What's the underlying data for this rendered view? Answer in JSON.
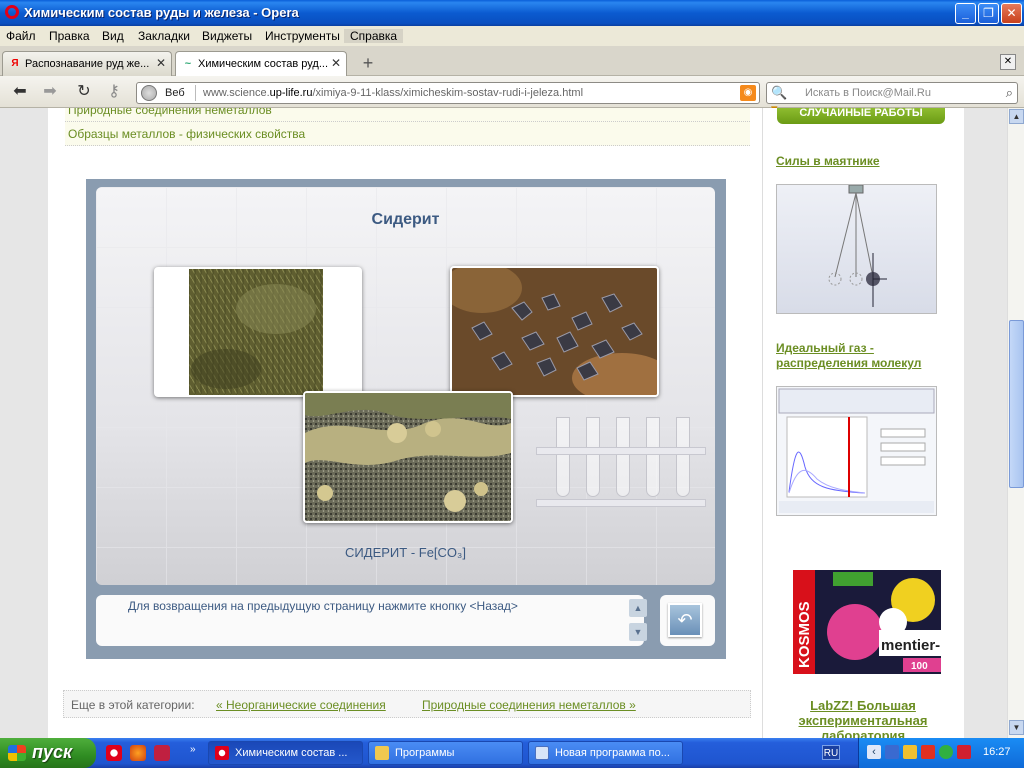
{
  "window": {
    "title": "Химическим состав руды и железа - Opera"
  },
  "menu": [
    "Файл",
    "Правка",
    "Вид",
    "Закладки",
    "Виджеты",
    "Инструменты",
    "Справка"
  ],
  "tabs": [
    {
      "label": "Распознавание руд же...",
      "favicon": "Я"
    },
    {
      "label": "Химическим состав руд...",
      "favicon": "~"
    }
  ],
  "address": {
    "web_label": "Веб",
    "url_host_prefix": "www.science.",
    "url_host_main": "up-life.ru",
    "url_path": "/ximiya-9-11-klass/ximicheskim-sostav-rudi-i-jeleza.html",
    "search_placeholder": "Искать в Поиск@Mail.Ru"
  },
  "page": {
    "links": [
      "Природные соединения неметаллов",
      "Образцы металлов - физических свойства"
    ],
    "flash": {
      "title": "Сидерит",
      "caption": "СИДЕРИТ - Fe[CO₃]",
      "message": "Для возвращения на предыдущую страницу нажмите кнопку <Назад>"
    },
    "category": {
      "label": "Еще в этой категории:",
      "links": [
        "« Неорганические соединения",
        "Природные соединения неметаллов »"
      ]
    }
  },
  "sidebar": {
    "button": "СЛУЧАЙНЫЕ РАБОТЫ",
    "items": [
      {
        "title": "Силы в маятнике"
      },
      {
        "title": "Идеальный газ - распределения молекул"
      },
      {
        "title": "LabZZ! Большая экспериментальная лаборатория"
      }
    ],
    "product": {
      "brand": "KOSMOS",
      "text": "mentier-",
      "badge": "100"
    }
  },
  "taskbar": {
    "start": "пуск",
    "tasks": [
      "Химическим состав ...",
      "Программы",
      "Новая программа по..."
    ],
    "lang": "RU",
    "clock": "16:27"
  },
  "colors": {
    "link_green": "#6b8e23",
    "flash_blue": "#3c5a82",
    "xp_blue": "#245edb"
  }
}
